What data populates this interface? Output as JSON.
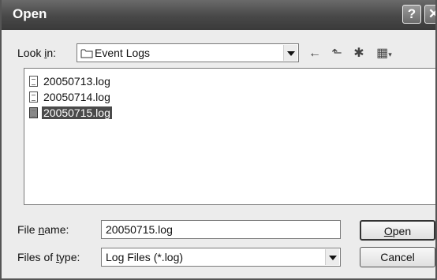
{
  "window": {
    "title": "Open",
    "help_label": "?",
    "close_label": "✕"
  },
  "lookin": {
    "label_pre": "Look ",
    "label_key": "i",
    "label_post": "n:",
    "value": "Event Logs"
  },
  "toolbar": {
    "back_icon": "←",
    "up_icon": "⬑",
    "new_folder_icon": "✱",
    "views_icon": "▦"
  },
  "files": [
    {
      "name": "20050713.log",
      "selected": false
    },
    {
      "name": "20050714.log",
      "selected": false
    },
    {
      "name": "20050715.log",
      "selected": true
    }
  ],
  "filename": {
    "label_pre": "File ",
    "label_key": "n",
    "label_post": "ame:",
    "value": "20050715.log"
  },
  "filetype": {
    "label_pre": "Files of ",
    "label_key": "t",
    "label_post": "ype:",
    "value": "Log Files (*.log)"
  },
  "buttons": {
    "open_key": "O",
    "open_rest": "pen",
    "cancel": "Cancel"
  }
}
